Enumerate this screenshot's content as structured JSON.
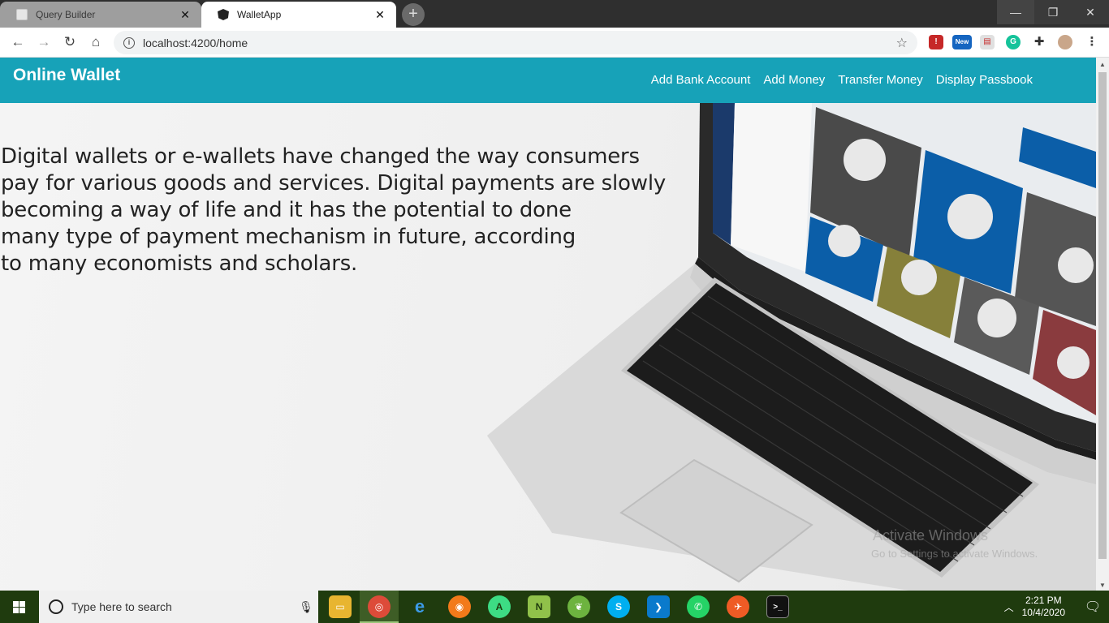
{
  "browser": {
    "tabs": [
      {
        "title": "Query Builder",
        "active": false
      },
      {
        "title": "WalletApp",
        "active": true
      }
    ],
    "new_tab_glyph": "+",
    "url": "localhost:4200/home",
    "controls": {
      "minimize": "—",
      "maximize": "❐",
      "close": "✕"
    },
    "extensions": [
      "red-extension-icon",
      "new-badge-extension-icon",
      "reader-extension-icon",
      "grammarly-icon",
      "puzzle-icon",
      "profile-avatar"
    ],
    "new_badge": "New"
  },
  "app": {
    "brand": "Online Wallet",
    "nav_links": [
      "Add Bank Account",
      "Add Money",
      "Transfer Money",
      "Display Passbook"
    ],
    "lead_lines": [
      "Digital wallets or e-wallets have changed the way consumers",
      "pay for various goods and services. Digital payments are slowly",
      "becoming a way of life and it has the potential to done",
      "many type of payment mechanism in future, according",
      "to many economists and scholars."
    ],
    "accent_color": "#17a2b8"
  },
  "watermark": {
    "line1": "Activate Windows",
    "line2": "Go to Settings to activate Windows."
  },
  "taskbar": {
    "search_placeholder": "Type here to search",
    "pinned": [
      "file-explorer-icon",
      "chrome-icon",
      "edge-icon",
      "firefox-icon",
      "android-studio-icon",
      "notepad-plus-icon",
      "spring-tool-icon",
      "skype-icon",
      "vscode-icon",
      "whatsapp-icon",
      "postman-icon",
      "terminal-icon"
    ],
    "time": "2:21 PM",
    "date": "10/4/2020"
  }
}
